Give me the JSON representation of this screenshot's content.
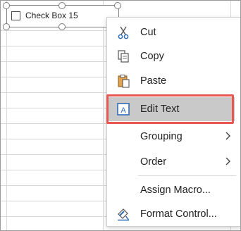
{
  "checkbox": {
    "label": "Check Box 15"
  },
  "menu": {
    "items": [
      {
        "label": "Cut",
        "icon": "scissors-icon",
        "has_submenu": false
      },
      {
        "label": "Copy",
        "icon": "copy-icon",
        "has_submenu": false
      },
      {
        "label": "Paste",
        "icon": "paste-icon",
        "has_submenu": false
      },
      {
        "label": "Edit Text",
        "icon": "edit-text-icon",
        "has_submenu": false,
        "highlighted": true
      },
      {
        "label": "Grouping",
        "icon": "",
        "has_submenu": true
      },
      {
        "label": "Order",
        "icon": "",
        "has_submenu": true
      },
      {
        "label": "Assign Macro...",
        "icon": "",
        "has_submenu": false
      },
      {
        "label": "Format Control...",
        "icon": "format-control-icon",
        "has_submenu": false
      }
    ]
  },
  "colors": {
    "highlight_bg": "#c9c9c9",
    "focus_outline": "#e8574f",
    "icon_blue": "#2f6db5"
  }
}
